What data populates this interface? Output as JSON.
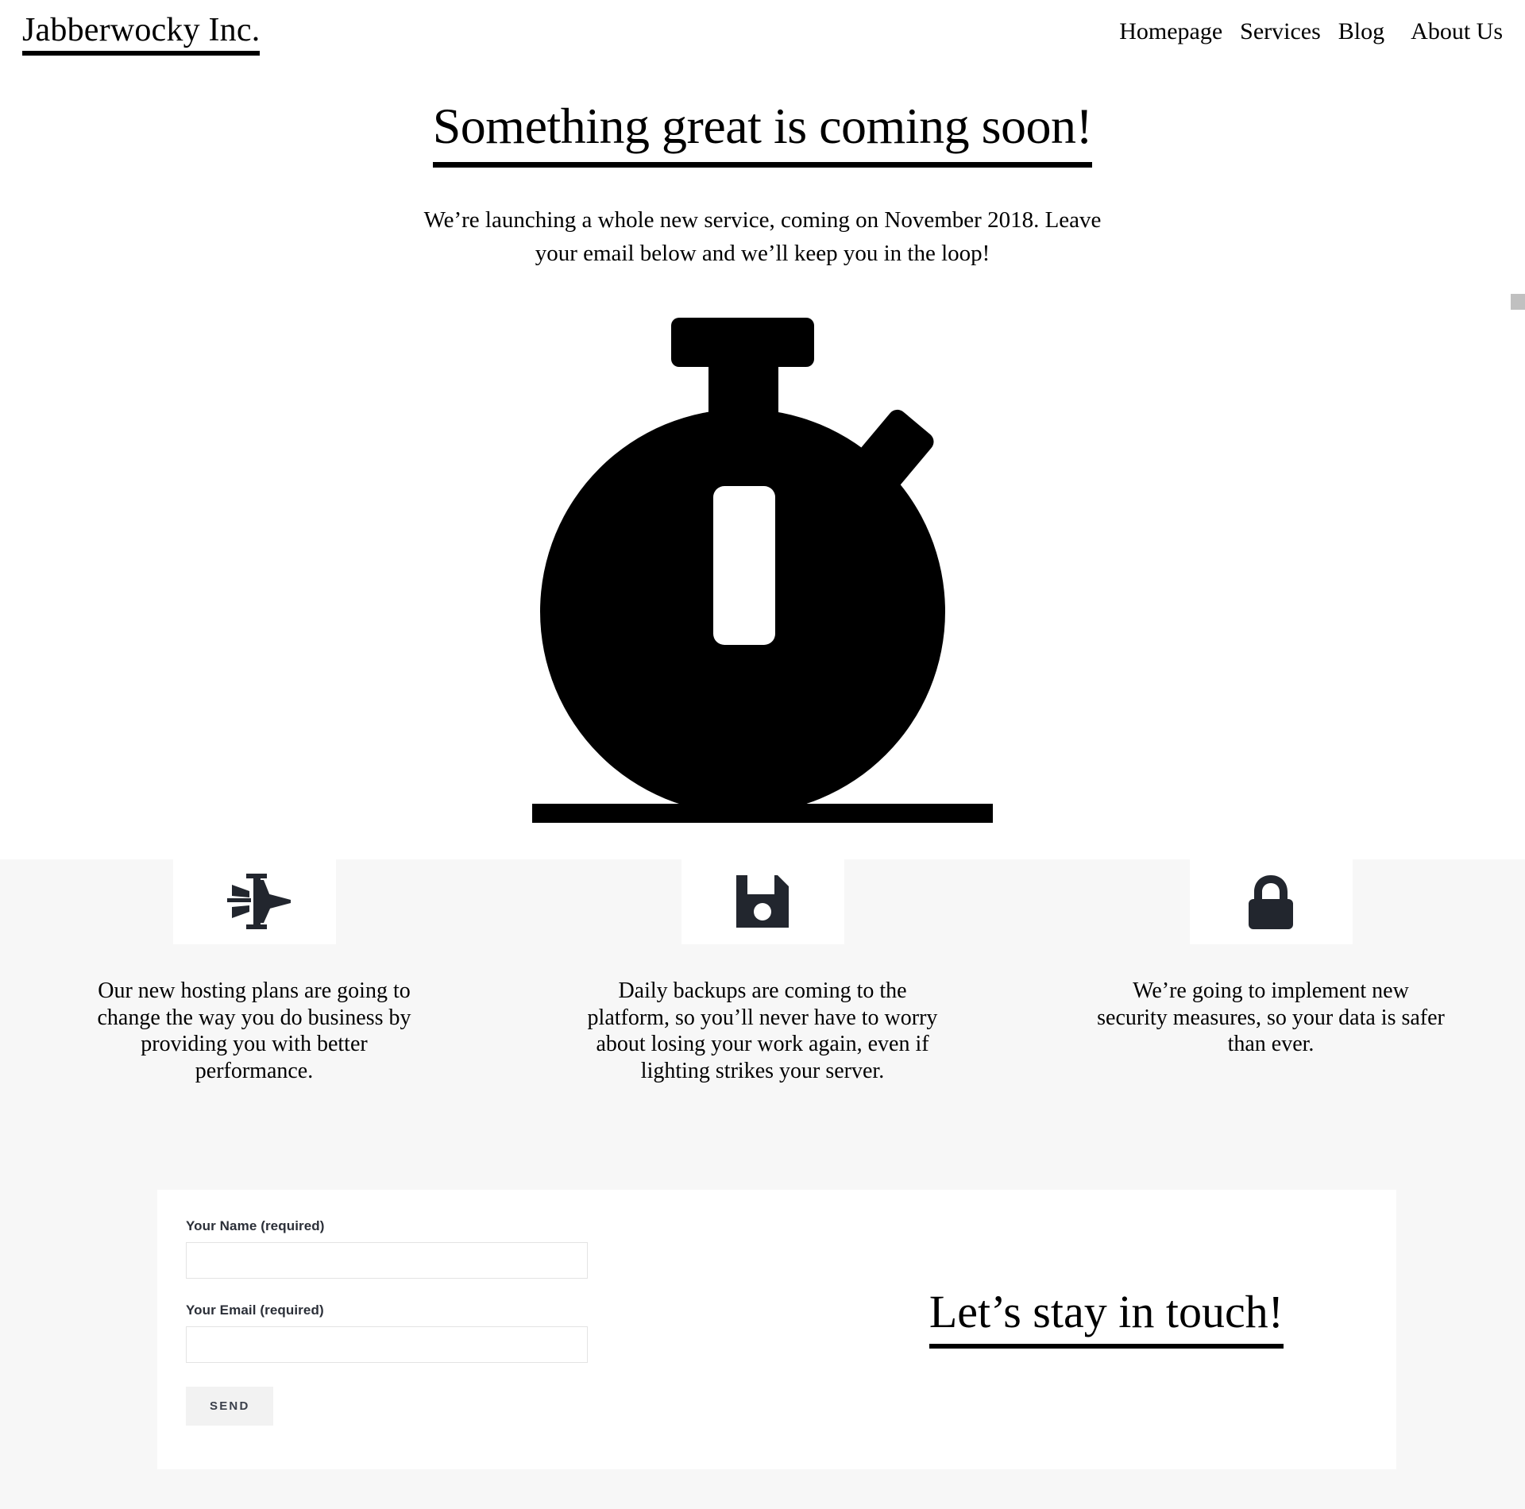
{
  "header": {
    "brand": "Jabberwocky Inc.",
    "nav": [
      {
        "label": "Homepage"
      },
      {
        "label": "Services"
      },
      {
        "label": "Blog"
      },
      {
        "label": "About Us"
      }
    ]
  },
  "hero": {
    "title": "Something great is coming soon!",
    "subtitle": "We’re launching a whole new service, coming on November 2018. Leave your email below and we’ll keep you in the loop!",
    "icon": "stopwatch-icon"
  },
  "features": [
    {
      "icon": "jet-plane-icon",
      "text": "Our new hosting plans are going to change the way you do business by providing you with better performance."
    },
    {
      "icon": "floppy-disk-save-icon",
      "text": "Daily backups are coming to the platform, so you’ll never have to worry about losing your work again, even if lighting strikes your server."
    },
    {
      "icon": "lock-icon",
      "text": "We’re going to implement new security measures, so your data is safer than ever."
    }
  ],
  "contact": {
    "headline": "Let’s stay in touch!",
    "name_label": "Your Name (required)",
    "name_value": "",
    "name_placeholder": "",
    "email_label": "Your Email (required)",
    "email_value": "",
    "email_placeholder": "",
    "send_label": "SEND"
  },
  "colors": {
    "text": "#000000",
    "band_background": "#f7f7f7",
    "card_background": "#ffffff",
    "icon_dark": "#22262e",
    "input_border": "#e3e3e3",
    "button_background": "#f2f2f2",
    "label_text": "#2b2f38",
    "scrollbar_thumb": "#c0c0c0"
  }
}
